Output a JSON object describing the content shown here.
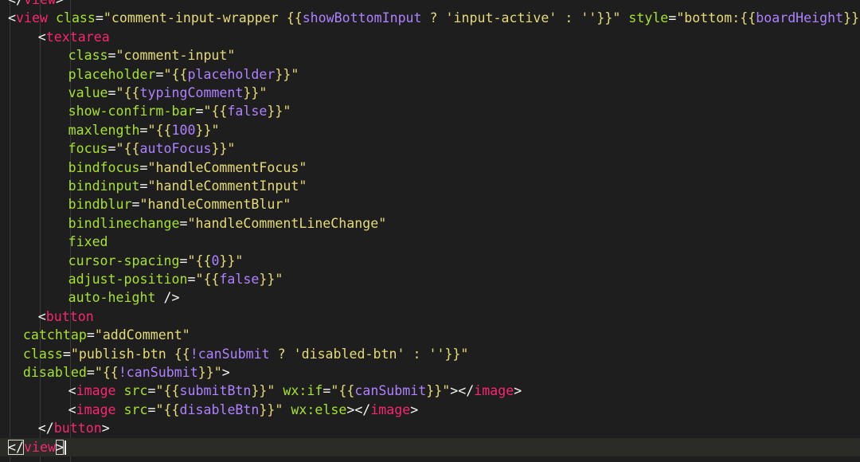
{
  "editor": {
    "language": "wxml",
    "lines": [
      [
        {
          "t": "</",
          "c": "punc"
        },
        {
          "t": "view",
          "c": "tag"
        },
        {
          "t": ">",
          "c": "punc"
        }
      ],
      [
        {
          "t": "<",
          "c": "punc"
        },
        {
          "t": "view",
          "c": "tag"
        },
        {
          "t": " class",
          "c": "attr"
        },
        {
          "t": "=",
          "c": "punc"
        },
        {
          "t": "\"comment-input-wrapper ",
          "c": "str"
        },
        {
          "t": "{{",
          "c": "str"
        },
        {
          "t": "showBottomInput",
          "c": "expr"
        },
        {
          "t": " ? ",
          "c": "str"
        },
        {
          "t": "'input-active'",
          "c": "str"
        },
        {
          "t": " : ",
          "c": "str"
        },
        {
          "t": "''",
          "c": "str"
        },
        {
          "t": "}}\"",
          "c": "str"
        },
        {
          "t": " style",
          "c": "attr"
        },
        {
          "t": "=",
          "c": "punc"
        },
        {
          "t": "\"bottom:",
          "c": "str"
        },
        {
          "t": "{{",
          "c": "str"
        },
        {
          "t": "boardHeight",
          "c": "expr"
        },
        {
          "t": "}}px\"",
          "c": "str"
        },
        {
          "t": ">",
          "c": "punc"
        }
      ],
      [
        {
          "t": "<",
          "c": "punc"
        },
        {
          "t": "textarea",
          "c": "tag"
        }
      ],
      [
        {
          "t": "class",
          "c": "attr"
        },
        {
          "t": "=",
          "c": "punc"
        },
        {
          "t": "\"comment-input\"",
          "c": "str"
        }
      ],
      [
        {
          "t": "placeholder",
          "c": "attr"
        },
        {
          "t": "=",
          "c": "punc"
        },
        {
          "t": "\"{{",
          "c": "str"
        },
        {
          "t": "placeholder",
          "c": "expr"
        },
        {
          "t": "}}\"",
          "c": "str"
        }
      ],
      [
        {
          "t": "value",
          "c": "attr"
        },
        {
          "t": "=",
          "c": "punc"
        },
        {
          "t": "\"{{",
          "c": "str"
        },
        {
          "t": "typingComment",
          "c": "expr"
        },
        {
          "t": "}}\"",
          "c": "str"
        }
      ],
      [
        {
          "t": "show-confirm-bar",
          "c": "attr"
        },
        {
          "t": "=",
          "c": "punc"
        },
        {
          "t": "\"{{",
          "c": "str"
        },
        {
          "t": "false",
          "c": "expr"
        },
        {
          "t": "}}\"",
          "c": "str"
        }
      ],
      [
        {
          "t": "maxlength",
          "c": "attr"
        },
        {
          "t": "=",
          "c": "punc"
        },
        {
          "t": "\"{{",
          "c": "str"
        },
        {
          "t": "100",
          "c": "expr"
        },
        {
          "t": "}}\"",
          "c": "str"
        }
      ],
      [
        {
          "t": "focus",
          "c": "attr"
        },
        {
          "t": "=",
          "c": "punc"
        },
        {
          "t": "\"{{",
          "c": "str"
        },
        {
          "t": "autoFocus",
          "c": "expr"
        },
        {
          "t": "}}\"",
          "c": "str"
        }
      ],
      [
        {
          "t": "bindfocus",
          "c": "attr"
        },
        {
          "t": "=",
          "c": "punc"
        },
        {
          "t": "\"handleCommentFocus\"",
          "c": "str"
        }
      ],
      [
        {
          "t": "bindinput",
          "c": "attr"
        },
        {
          "t": "=",
          "c": "punc"
        },
        {
          "t": "\"handleCommentInput\"",
          "c": "str"
        }
      ],
      [
        {
          "t": "bindblur",
          "c": "attr"
        },
        {
          "t": "=",
          "c": "punc"
        },
        {
          "t": "\"handleCommentBlur\"",
          "c": "str"
        }
      ],
      [
        {
          "t": "bindlinechange",
          "c": "attr"
        },
        {
          "t": "=",
          "c": "punc"
        },
        {
          "t": "\"handleCommentLineChange\"",
          "c": "str"
        }
      ],
      [
        {
          "t": "fixed",
          "c": "attr"
        }
      ],
      [
        {
          "t": "cursor-spacing",
          "c": "attr"
        },
        {
          "t": "=",
          "c": "punc"
        },
        {
          "t": "\"{{",
          "c": "str"
        },
        {
          "t": "0",
          "c": "expr"
        },
        {
          "t": "}}\"",
          "c": "str"
        }
      ],
      [
        {
          "t": "adjust-position",
          "c": "attr"
        },
        {
          "t": "=",
          "c": "punc"
        },
        {
          "t": "\"{{",
          "c": "str"
        },
        {
          "t": "false",
          "c": "expr"
        },
        {
          "t": "}}\"",
          "c": "str"
        }
      ],
      [
        {
          "t": "auto-height",
          "c": "attr"
        },
        {
          "t": " />",
          "c": "punc"
        }
      ],
      [
        {
          "t": "<",
          "c": "punc"
        },
        {
          "t": "button",
          "c": "tag"
        }
      ],
      [
        {
          "t": "catchtap",
          "c": "attr"
        },
        {
          "t": "=",
          "c": "punc"
        },
        {
          "t": "\"addComment\"",
          "c": "str"
        }
      ],
      [
        {
          "t": "class",
          "c": "attr"
        },
        {
          "t": "=",
          "c": "punc"
        },
        {
          "t": "\"publish-btn ",
          "c": "str"
        },
        {
          "t": "{{",
          "c": "str"
        },
        {
          "t": "!canSubmit",
          "c": "expr"
        },
        {
          "t": " ? ",
          "c": "str"
        },
        {
          "t": "'disabled-btn'",
          "c": "str"
        },
        {
          "t": " : ",
          "c": "str"
        },
        {
          "t": "''",
          "c": "str"
        },
        {
          "t": "}}\"",
          "c": "str"
        }
      ],
      [
        {
          "t": "disabled",
          "c": "attr"
        },
        {
          "t": "=",
          "c": "punc"
        },
        {
          "t": "\"{{",
          "c": "str"
        },
        {
          "t": "!canSubmit",
          "c": "expr"
        },
        {
          "t": "}}\"",
          "c": "str"
        },
        {
          "t": ">",
          "c": "punc"
        }
      ],
      [
        {
          "t": "<",
          "c": "punc"
        },
        {
          "t": "image",
          "c": "tag"
        },
        {
          "t": " src",
          "c": "attr"
        },
        {
          "t": "=",
          "c": "punc"
        },
        {
          "t": "\"{{",
          "c": "str"
        },
        {
          "t": "submitBtn",
          "c": "expr"
        },
        {
          "t": "}}\"",
          "c": "str"
        },
        {
          "t": " wx:if",
          "c": "attr"
        },
        {
          "t": "=",
          "c": "punc"
        },
        {
          "t": "\"{{",
          "c": "str"
        },
        {
          "t": "canSubmit",
          "c": "expr"
        },
        {
          "t": "}}\"",
          "c": "str"
        },
        {
          "t": "></",
          "c": "punc"
        },
        {
          "t": "image",
          "c": "tag"
        },
        {
          "t": ">",
          "c": "punc"
        }
      ],
      [
        {
          "t": "<",
          "c": "punc"
        },
        {
          "t": "image",
          "c": "tag"
        },
        {
          "t": " src",
          "c": "attr"
        },
        {
          "t": "=",
          "c": "punc"
        },
        {
          "t": "\"{{",
          "c": "str"
        },
        {
          "t": "disableBtn",
          "c": "expr"
        },
        {
          "t": "}}\"",
          "c": "str"
        },
        {
          "t": " wx:else",
          "c": "attr"
        },
        {
          "t": "></",
          "c": "punc"
        },
        {
          "t": "image",
          "c": "tag"
        },
        {
          "t": ">",
          "c": "punc"
        }
      ],
      [
        {
          "t": "</",
          "c": "punc"
        },
        {
          "t": "button",
          "c": "tag"
        },
        {
          "t": ">",
          "c": "punc"
        }
      ],
      [
        {
          "t": "</",
          "c": "punc"
        },
        {
          "t": "view",
          "c": "tag"
        },
        {
          "t": ">",
          "c": "punc"
        }
      ]
    ],
    "current_line": 24,
    "colors": {
      "background": "#1e1e1e",
      "tag": "#f92672",
      "attribute": "#a6e22e",
      "string": "#e6db74",
      "expression": "#ae81ff",
      "punctuation": "#f8f8f2"
    }
  }
}
